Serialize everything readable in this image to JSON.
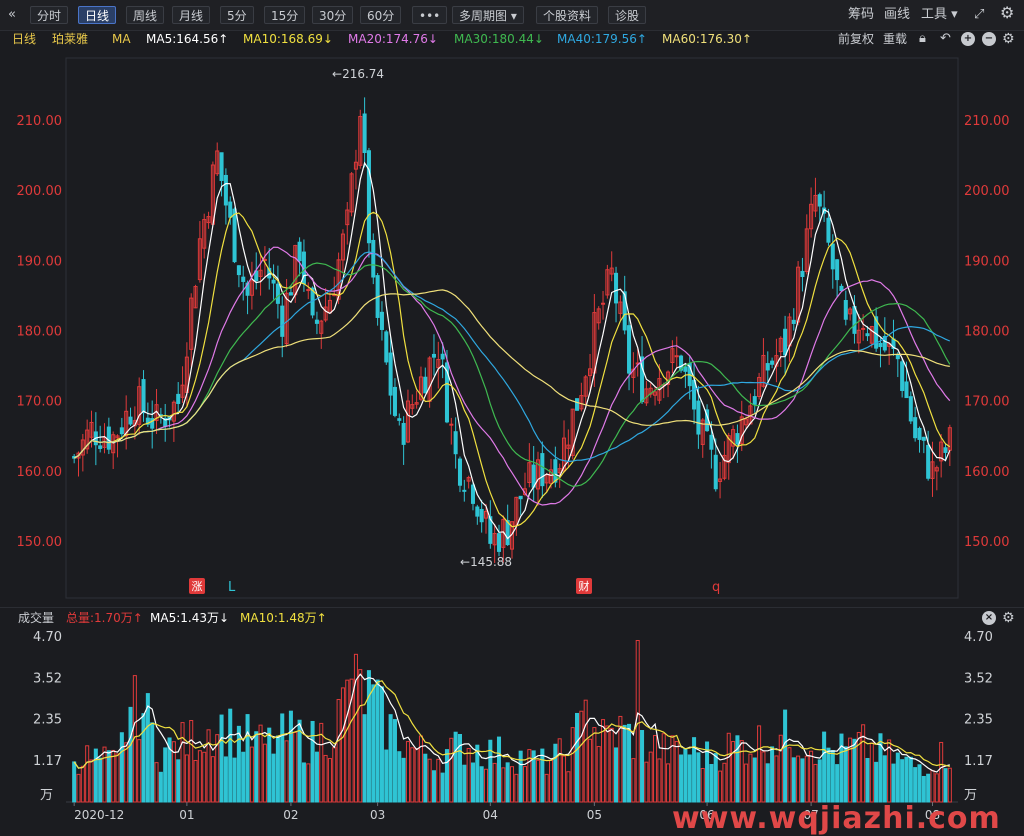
{
  "toolbar": {
    "back": "«",
    "intraday": "分时",
    "daily": "日线",
    "weekly": "周线",
    "monthly": "月线",
    "m5": "5分",
    "m15": "15分",
    "m30": "30分",
    "m60": "60分",
    "more": "•••",
    "multi_period": "多周期图 ▾",
    "stock_info": "个股资料",
    "diagnose": "诊股",
    "chips": "筹码",
    "draw": "画线",
    "tools": "工具 ▾",
    "fullscreen": "⤢"
  },
  "indicator_bar": {
    "period": "日线",
    "stock_name": "珀莱雅",
    "ma_label": "MA",
    "ma5": "MA5:164.56↑",
    "ma10": "MA10:168.69↓",
    "ma20": "MA20:174.76↓",
    "ma30": "MA30:180.44↓",
    "ma40": "MA40:179.56↑",
    "ma60": "MA60:176.30↑",
    "adjust": "前复权",
    "reload": "重载"
  },
  "volume_bar": {
    "label": "成交量",
    "total": "总量:1.70万↑",
    "ma5": "MA5:1.43万↓",
    "ma10": "MA10:1.48万↑",
    "unit": "万"
  },
  "markers": {
    "zhang": "涨",
    "l": "L",
    "cai": "财",
    "q": "q"
  },
  "chart_data": {
    "type": "candlestick",
    "price_axis": {
      "ticks": [
        "210.00",
        "200.00",
        "190.00",
        "180.00",
        "170.00",
        "160.00",
        "150.00"
      ],
      "values": [
        210,
        200,
        190,
        180,
        170,
        160,
        150
      ],
      "ylim": [
        142,
        219
      ]
    },
    "volume_axis": {
      "ticks": [
        "4.70",
        "3.52",
        "2.35",
        "1.17"
      ],
      "values": [
        4.7,
        3.52,
        2.35,
        1.17
      ],
      "ylim": [
        0,
        4.7
      ]
    },
    "x_labels": [
      "2020-12",
      "01",
      "02",
      "03",
      "04",
      "05",
      "06",
      "07",
      "08"
    ],
    "annotations": {
      "high": "216.74",
      "low": "145.88"
    },
    "colors": {
      "up": "#e03a3a",
      "down": "#2fc4d4",
      "ma5": "#ffffff",
      "ma10": "#f0e040",
      "ma20": "#e07ae8",
      "ma30": "#3fb950",
      "ma40": "#2fa8e0",
      "ma60": "#f0e07a",
      "axis_text": "#e03a3a",
      "vol_axis_text": "#cfd2d6"
    },
    "price_keyframes": [
      [
        0,
        162
      ],
      [
        4,
        166
      ],
      [
        9,
        165
      ],
      [
        14,
        170
      ],
      [
        19,
        167
      ],
      [
        24,
        170
      ],
      [
        29,
        193
      ],
      [
        33,
        205
      ],
      [
        36,
        195
      ],
      [
        40,
        185
      ],
      [
        44,
        190
      ],
      [
        48,
        182
      ],
      [
        52,
        192
      ],
      [
        55,
        180
      ],
      [
        59,
        185
      ],
      [
        63,
        195
      ],
      [
        66,
        212
      ],
      [
        69,
        185
      ],
      [
        72,
        175
      ],
      [
        75,
        165
      ],
      [
        80,
        173
      ],
      [
        84,
        178
      ],
      [
        88,
        162
      ],
      [
        92,
        158
      ],
      [
        96,
        150
      ],
      [
        100,
        152
      ],
      [
        104,
        158
      ],
      [
        108,
        160
      ],
      [
        112,
        162
      ],
      [
        116,
        170
      ],
      [
        120,
        180
      ],
      [
        124,
        188
      ],
      [
        128,
        175
      ],
      [
        132,
        172
      ],
      [
        136,
        175
      ],
      [
        140,
        176
      ],
      [
        144,
        166
      ],
      [
        148,
        160
      ],
      [
        152,
        165
      ],
      [
        156,
        170
      ],
      [
        160,
        175
      ],
      [
        164,
        178
      ],
      [
        168,
        190
      ],
      [
        171,
        199
      ],
      [
        174,
        192
      ],
      [
        178,
        180
      ],
      [
        182,
        182
      ],
      [
        186,
        178
      ],
      [
        190,
        176
      ],
      [
        194,
        165
      ],
      [
        198,
        160
      ],
      [
        202,
        164
      ]
    ],
    "volume_keyframes": [
      [
        0,
        1.3
      ],
      [
        10,
        1.1
      ],
      [
        14,
        3.2
      ],
      [
        20,
        1.4
      ],
      [
        28,
        1.8
      ],
      [
        33,
        2.2
      ],
      [
        38,
        1.9
      ],
      [
        44,
        1.6
      ],
      [
        50,
        1.9
      ],
      [
        55,
        1.7
      ],
      [
        60,
        2.1
      ],
      [
        64,
        3.3
      ],
      [
        68,
        3.0
      ],
      [
        72,
        2.2
      ],
      [
        78,
        1.5
      ],
      [
        84,
        1.3
      ],
      [
        90,
        1.6
      ],
      [
        96,
        1.4
      ],
      [
        102,
        1.3
      ],
      [
        108,
        1.1
      ],
      [
        114,
        1.4
      ],
      [
        118,
        2.4
      ],
      [
        122,
        1.8
      ],
      [
        126,
        2.0
      ],
      [
        132,
        1.6
      ],
      [
        138,
        1.4
      ],
      [
        142,
        1.5
      ],
      [
        146,
        1.3
      ],
      [
        152,
        1.6
      ],
      [
        158,
        1.7
      ],
      [
        164,
        1.9
      ],
      [
        170,
        1.7
      ],
      [
        176,
        1.4
      ],
      [
        182,
        1.6
      ],
      [
        188,
        1.3
      ],
      [
        194,
        1.0
      ],
      [
        198,
        1.2
      ],
      [
        202,
        1.4
      ]
    ],
    "candle_count": 203
  }
}
